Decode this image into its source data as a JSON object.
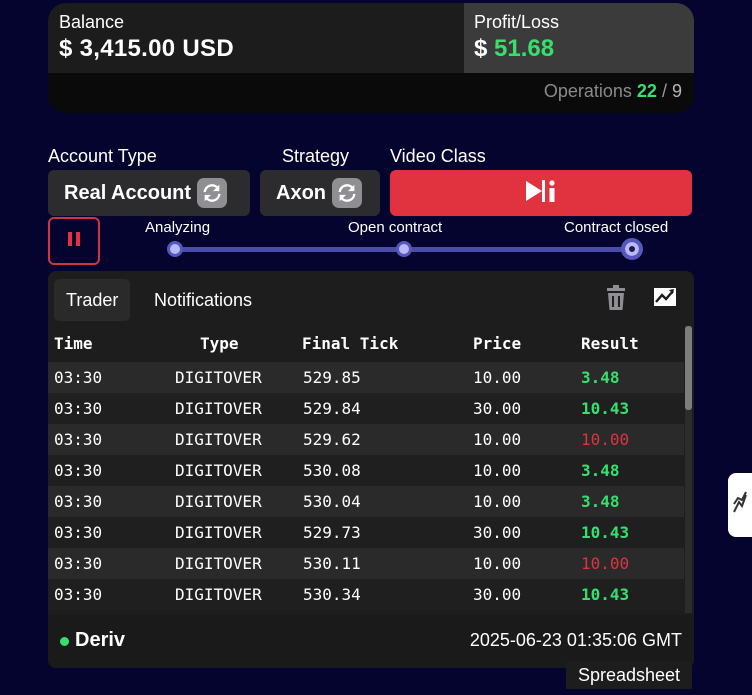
{
  "balance": {
    "label": "Balance",
    "value": "$ 3,415.00 USD"
  },
  "profit": {
    "label": "Profit/Loss",
    "currency": "$",
    "value": "51.68",
    "color": "#36e06e"
  },
  "operations": {
    "label": "Operations",
    "wins": "22",
    "separator": "/",
    "losses": "9"
  },
  "account_type": {
    "label": "Account Type",
    "value": "Real Account",
    "icon": "refresh-icon"
  },
  "strategy": {
    "label": "Strategy",
    "value": "Axon",
    "icon": "refresh-icon"
  },
  "video_class": {
    "label": "Video Class",
    "icon": "play-info-icon",
    "color": "#e0323f"
  },
  "pause": {
    "icon": "pause-icon"
  },
  "progress": {
    "steps": [
      {
        "label": "Analyzing"
      },
      {
        "label": "Open contract"
      },
      {
        "label": "Contract closed"
      }
    ],
    "active_step": 2
  },
  "tabs": [
    {
      "label": "Trader",
      "active": true
    },
    {
      "label": "Notifications",
      "active": false
    }
  ],
  "table": {
    "columns": [
      "Time",
      "Type",
      "Final Tick",
      "Price",
      "Result"
    ],
    "rows": [
      {
        "time": "03:30",
        "type": "DIGITOVER",
        "tick": "529.85",
        "price": "10.00",
        "result": "3.48",
        "status": "win"
      },
      {
        "time": "03:30",
        "type": "DIGITOVER",
        "tick": "529.84",
        "price": "30.00",
        "result": "10.43",
        "status": "win"
      },
      {
        "time": "03:30",
        "type": "DIGITOVER",
        "tick": "529.62",
        "price": "10.00",
        "result": "10.00",
        "status": "loss"
      },
      {
        "time": "03:30",
        "type": "DIGITOVER",
        "tick": "530.08",
        "price": "10.00",
        "result": "3.48",
        "status": "win"
      },
      {
        "time": "03:30",
        "type": "DIGITOVER",
        "tick": "530.04",
        "price": "10.00",
        "result": "3.48",
        "status": "win"
      },
      {
        "time": "03:30",
        "type": "DIGITOVER",
        "tick": "529.73",
        "price": "30.00",
        "result": "10.43",
        "status": "win"
      },
      {
        "time": "03:30",
        "type": "DIGITOVER",
        "tick": "530.11",
        "price": "10.00",
        "result": "10.00",
        "status": "loss"
      },
      {
        "time": "03:30",
        "type": "DIGITOVER",
        "tick": "530.34",
        "price": "30.00",
        "result": "10.43",
        "status": "win"
      }
    ]
  },
  "footer": {
    "broker": "Deriv",
    "status_color": "#36e06e",
    "timestamp": "2025-06-23 01:35:06 GMT"
  },
  "spreadsheet_label": "Spreadsheet",
  "colors": {
    "background": "#04042e",
    "win": "#36e06e",
    "loss": "#e0323f",
    "accent": "#5557bd"
  }
}
